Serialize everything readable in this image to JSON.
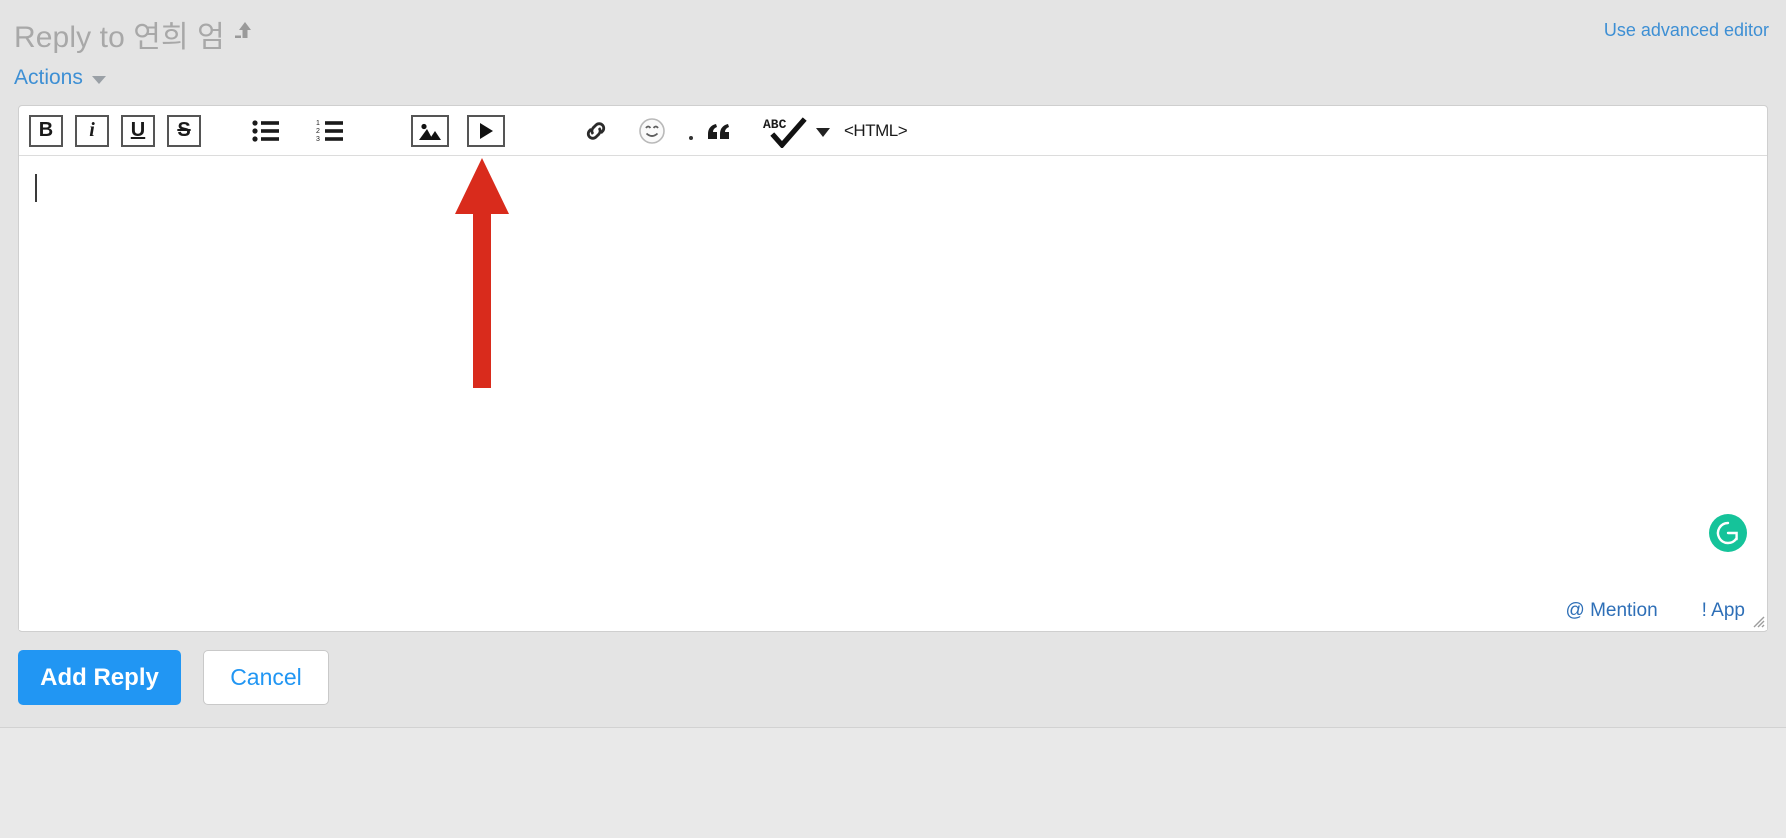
{
  "header": {
    "reply_title": "Reply to 연희 엄",
    "collapse_icon": "collapse-up-arrow-icon",
    "advanced_editor_link": "Use advanced editor"
  },
  "actions": {
    "label": "Actions",
    "caret_icon": "chevron-down-icon"
  },
  "toolbar": {
    "bold": "B",
    "italic": "i",
    "underline": "U",
    "strikethrough": "S",
    "bullet_list_icon": "bulleted-list-icon",
    "numbered_list_icon": "numbered-list-icon",
    "numbered_list_digits": [
      "1",
      "2",
      "3"
    ],
    "insert_image_icon": "insert-image-icon",
    "insert_video_icon": "insert-video-icon",
    "insert_link_icon": "link-icon",
    "emoji_icon": "emoji-smiley-icon",
    "separator_dot": "dot-separator",
    "blockquote_icon": "blockquote-quote-icon",
    "spellcheck_icon": "spellcheck-abc-check-icon",
    "spellcheck_caret_icon": "chevron-down-icon",
    "html_button": "<HTML>"
  },
  "editor": {
    "content": "",
    "caret_visible": true,
    "grammarly_icon": "grammarly-g-icon",
    "mention_link": "@ Mention",
    "app_link": "! App",
    "resize_grip_icon": "resize-grip-icon"
  },
  "buttons": {
    "submit": "Add Reply",
    "cancel": "Cancel"
  },
  "annotation": {
    "arrow_icon": "red-up-arrow-annotation",
    "arrow_color": "#d92b1c",
    "points_at": "insert-image-icon"
  },
  "colors": {
    "page_background": "#e4e4e4",
    "editor_background": "#ffffff",
    "link_blue": "#3d8fd4",
    "primary_button": "#2196f3",
    "grammarly_green": "#15c39a",
    "title_gray": "#a8a8a8",
    "annotation_red": "#d92b1c"
  }
}
